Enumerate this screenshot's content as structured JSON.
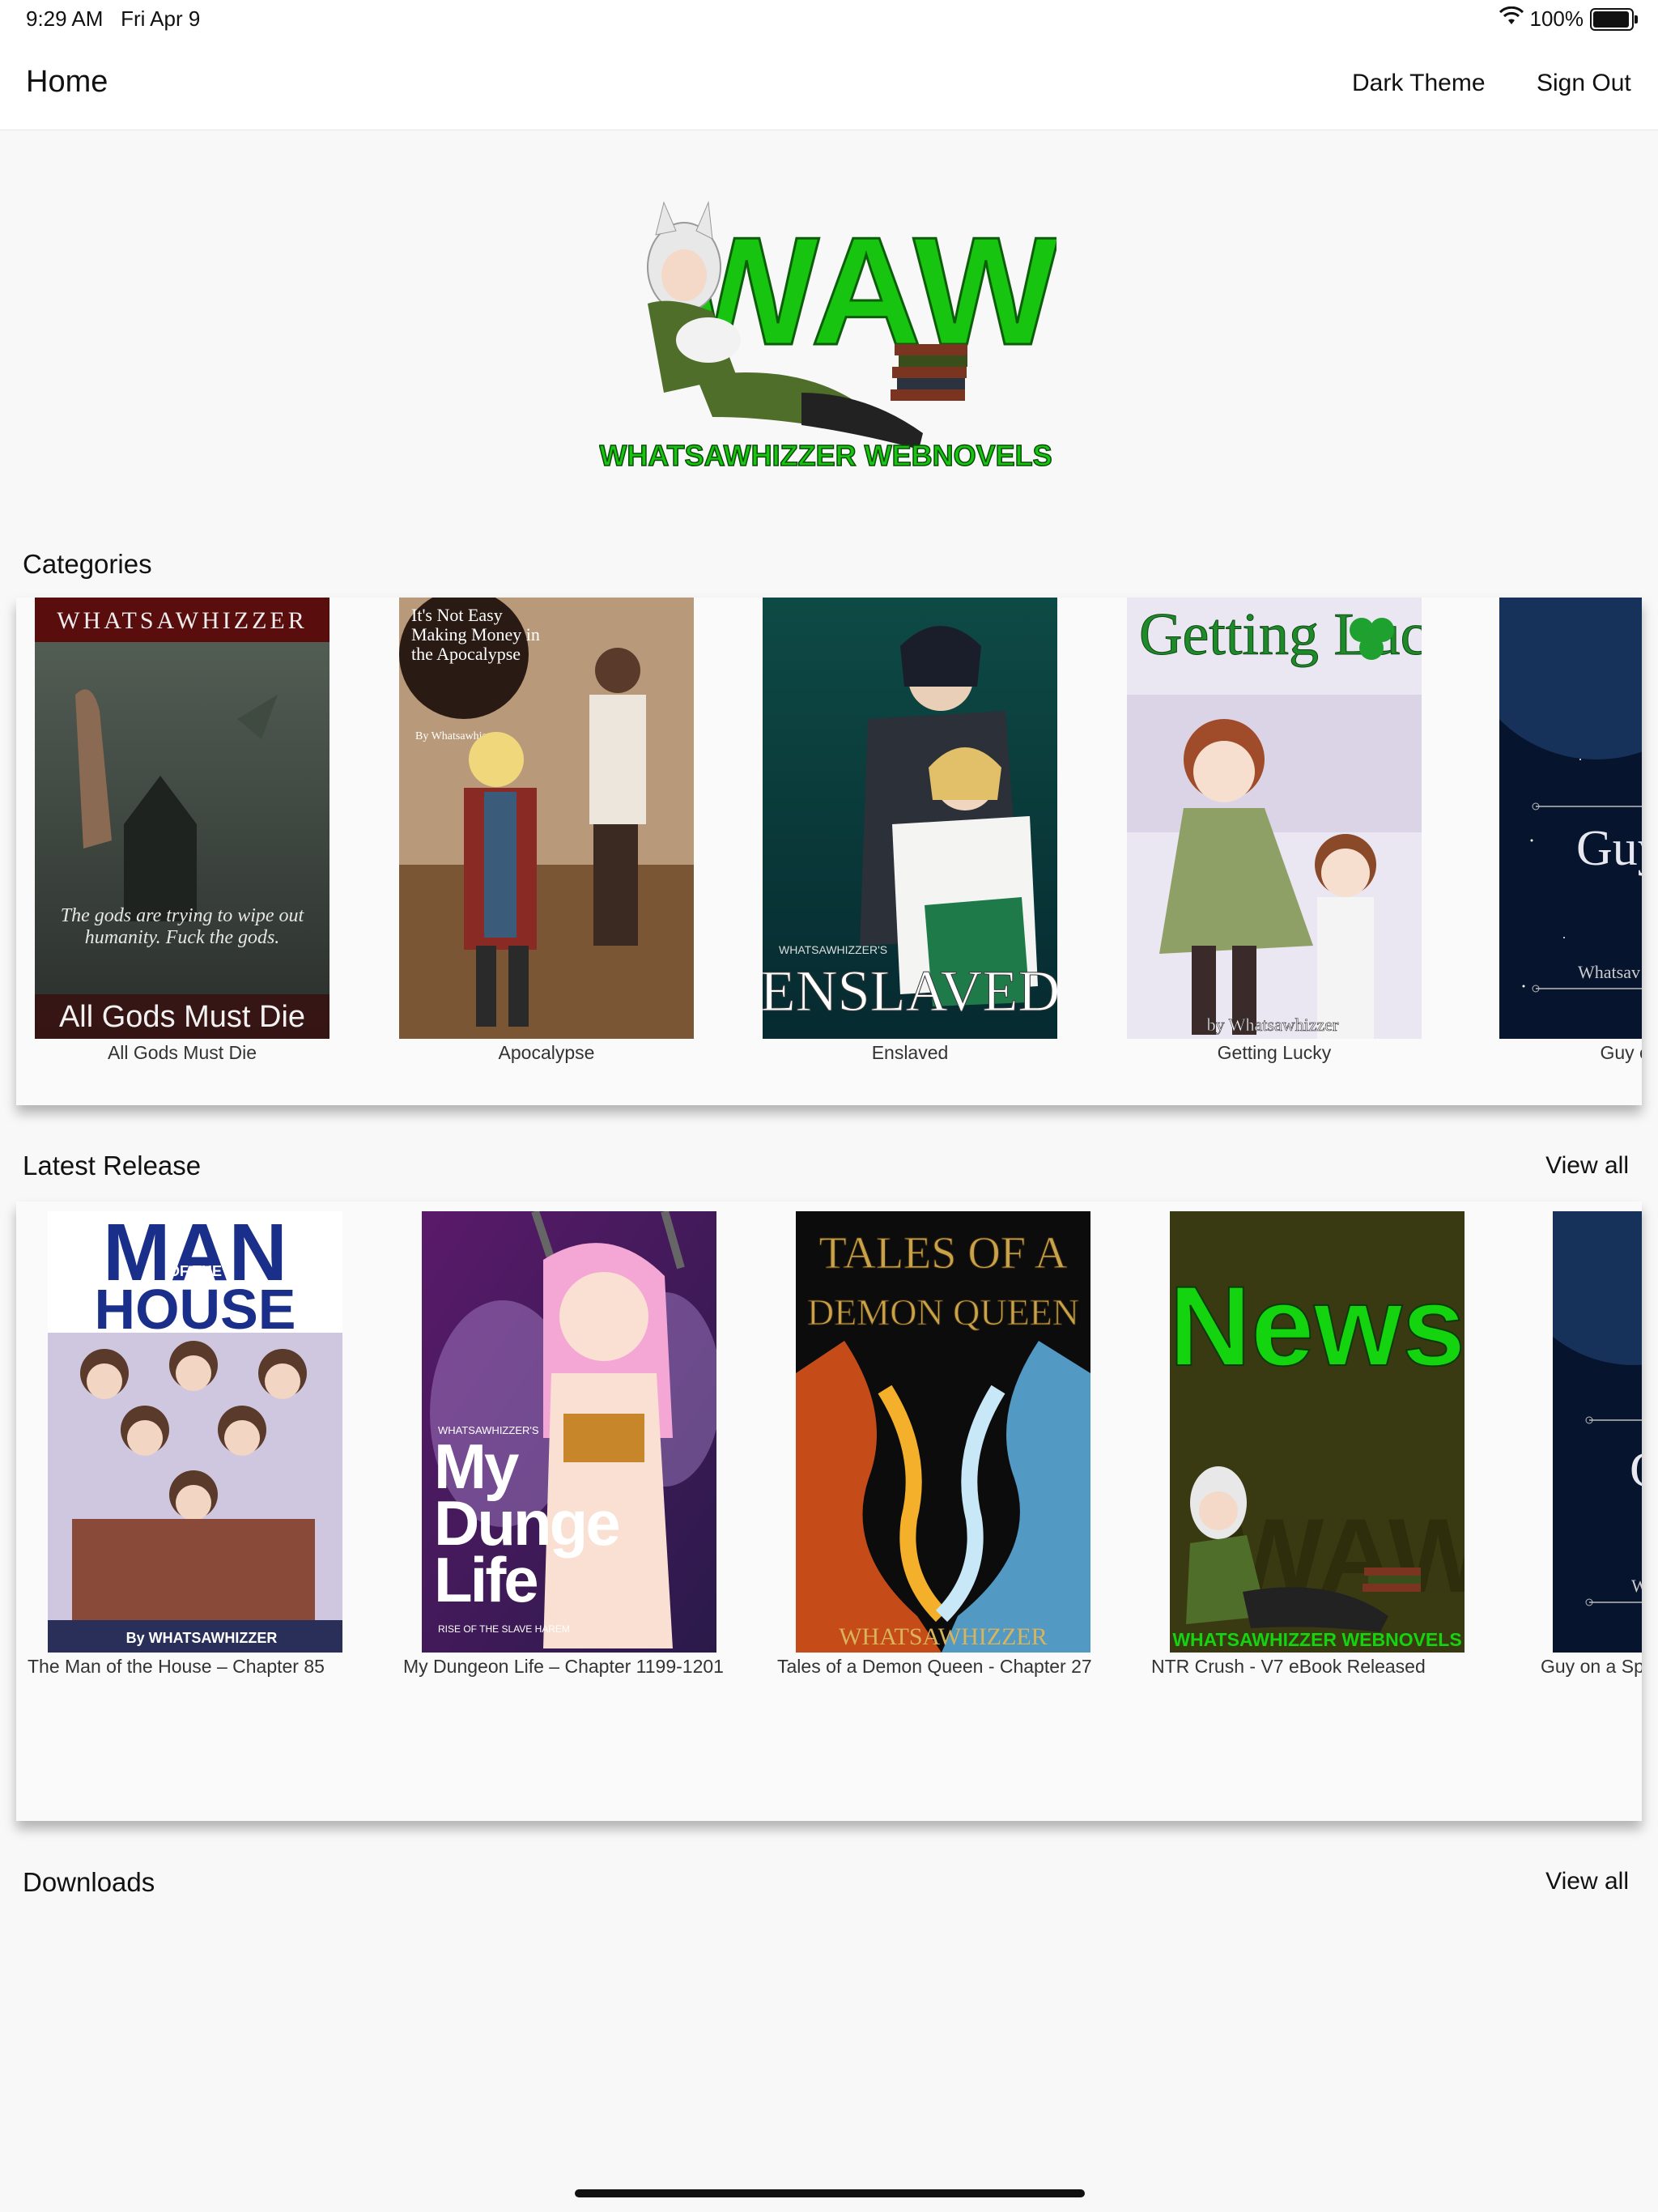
{
  "status_bar": {
    "time": "9:29 AM",
    "date": "Fri Apr 9",
    "battery": "100%",
    "battery_level": 1.0
  },
  "nav": {
    "title": "Home",
    "dark_theme": "Dark Theme",
    "sign_out": "Sign Out"
  },
  "logo": {
    "main": "WAW",
    "sub": "WHATSAWHIZZER WEBNOVELS"
  },
  "categories": {
    "title": "Categories",
    "items": [
      {
        "caption": "All Gods Must Die",
        "cover_top": "WHATSAWHIZZER",
        "cover_tagline": "The gods are trying to wipe out humanity. Fuck the gods.",
        "cover_title": "All Gods Must Die"
      },
      {
        "caption": "Apocalypse",
        "cover_title": "It's Not Easy Making Money in the Apocalypse",
        "cover_author": "By Whatsawhizzer"
      },
      {
        "caption": "Enslaved",
        "cover_sub": "WHATSAWHIZZER'S",
        "cover_title": "ENSLAVED"
      },
      {
        "caption": "Getting Lucky",
        "cover_title": "Getting Lucky",
        "cover_author": "by Whatsawhizzer"
      },
      {
        "caption": "Guy on a S",
        "cover_title": "Guy Space",
        "cover_author": "Whatsav"
      }
    ]
  },
  "latest": {
    "title": "Latest Release",
    "view_all": "View all",
    "items": [
      {
        "caption": "The Man of the House – Chapter 85",
        "cover_title_1": "MAN",
        "cover_title_mid": "OF THE",
        "cover_title_2": "HOUSE",
        "cover_author": "By WHATSAWHIZZER"
      },
      {
        "caption": "My Dungeon Life – Chapter 1199-1201",
        "cover_sub": "WHATSAWHIZZER'S",
        "cover_title": "My Dungeon Life",
        "cover_tagline": "RISE OF THE SLAVE HAREM"
      },
      {
        "caption": "Tales of a Demon Queen - Chapter 27",
        "cover_title_1": "TALES OF A",
        "cover_title_2": "DEMON QUEEN",
        "cover_author": "WHATSAWHIZZER"
      },
      {
        "caption": "NTR Crush - V7 eBook Released",
        "cover_title": "News",
        "cover_logo": "WAW",
        "cover_sub": "WHATSAWHIZZER WEBNOVELS"
      },
      {
        "caption": "Guy on a Spa",
        "cover_title": "G S",
        "cover_author": "W"
      }
    ]
  },
  "downloads": {
    "title": "Downloads",
    "view_all": "View all"
  }
}
